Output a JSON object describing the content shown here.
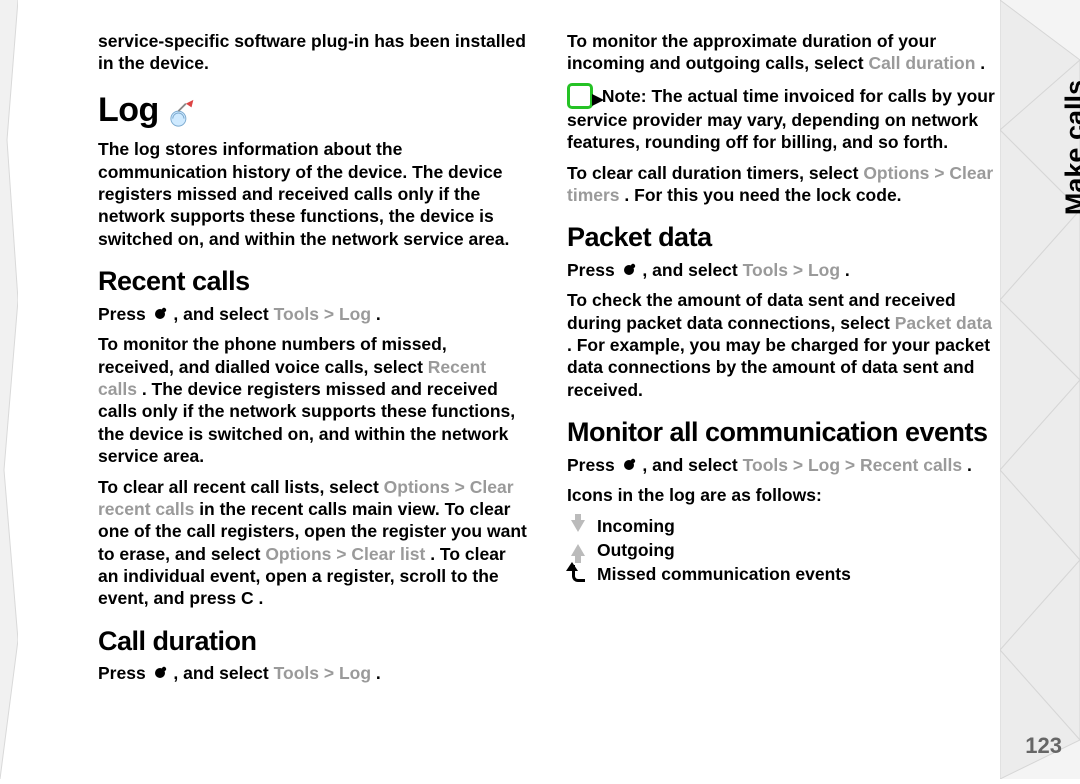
{
  "side": {
    "label": "Make calls",
    "page_number": "123"
  },
  "col1": {
    "intro": "service-specific software plug-in has been installed in the device.",
    "h1": "Log",
    "h1_icon": "log-icon",
    "log_desc": "The log stores information about the communication history of the device. The device registers missed and received calls only if the network supports these functions, the device is switched on, and within the network service area.",
    "h2a": "Recent calls",
    "recent_press_pre": "Press ",
    "recent_press_post": " , and select ",
    "recent_path_1": "Tools",
    "recent_path_gt": " > ",
    "recent_path_2": "Log",
    "recent_dot": ".",
    "recent_p1a": "To monitor the phone numbers of missed, received, and dialled voice calls, select ",
    "recent_p1b": "Recent calls",
    "recent_p1c": ". The device registers missed and received calls only if the network supports these functions, the device is switched on, and within the network service area.",
    "recent_p2a": "To clear all recent call lists, select ",
    "recent_p2b": "Options",
    "recent_p2c": " > ",
    "recent_p2d": "Clear recent calls",
    "recent_p2e": " in the recent calls main view. To clear one of the call registers, open the register you want to erase, and select ",
    "recent_p2f": "Options",
    "recent_p2g": " > ",
    "recent_p2h": "Clear list",
    "recent_p2i": ". To clear an individual event, open a register, scroll to the event, and press ",
    "recent_p2j": "C",
    "recent_p2k": ".",
    "h2b": "Call duration",
    "cd_press_pre": "Press ",
    "cd_press_post": " , and select ",
    "cd_path_1": "Tools",
    "cd_path_gt": " > ",
    "cd_path_2": "Log",
    "cd_dot": "."
  },
  "col2": {
    "p1a": "To monitor the approximate duration of your incoming and outgoing calls, select ",
    "p1b": "Call duration",
    "p1c": ".",
    "note_label": "Note:",
    "note_body": "  The actual time invoiced for calls by your service provider may vary, depending on network features, rounding off for billing, and so forth.",
    "clear_a": "To clear call duration timers, select ",
    "clear_b": "Options",
    "clear_c": " > ",
    "clear_d": "Clear timers",
    "clear_e": ". For this you need the lock code.",
    "h2a": "Packet data",
    "pd_press_pre": "Press ",
    "pd_press_post": " , and select ",
    "pd_path_1": "Tools",
    "pd_path_gt": " > ",
    "pd_path_2": "Log",
    "pd_dot": ".",
    "pd_body_a": "To check the amount of data sent and received during packet data connections, select ",
    "pd_body_b": "Packet data",
    "pd_body_c": ". For example, you may be charged for your packet data connections by the amount of data sent and received.",
    "h2b": "Monitor all communication events",
    "mon_press_pre": "Press ",
    "mon_press_post": " , and select ",
    "mon_path_1": "Tools",
    "mon_path_gt1": " > ",
    "mon_path_2": "Log",
    "mon_path_gt2": " > ",
    "mon_path_3": "Recent calls",
    "mon_dot": ".",
    "icons_intro": "Icons in the log are as follows:",
    "li1": "Incoming",
    "li2": "Outgoing",
    "li3": "Missed communication events"
  }
}
